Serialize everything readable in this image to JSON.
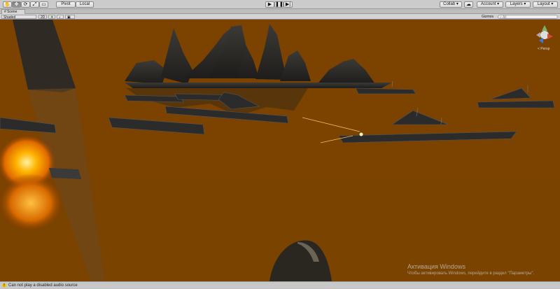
{
  "toolbar": {
    "tools": [
      "hand-icon",
      "move-icon",
      "rotate-icon",
      "scale-icon",
      "rect-icon"
    ],
    "pivot_label": "Pivot",
    "local_label": "Local",
    "collab_label": "Collab ▾",
    "account_label": "Account ▾",
    "layers_label": "Layers ▾",
    "layout_label": "Layout ▾"
  },
  "tabs": {
    "scene_label": "Scene"
  },
  "scenebar": {
    "shading_mode": "Shaded",
    "mode_2d": "2D",
    "gizmos_label": "Gizmos ▾",
    "search_placeholder": "All"
  },
  "viewport": {
    "persp_label": "< Persp",
    "sky_color": "#7d4300",
    "accent_colors": {
      "explosion": "#ffb000",
      "ship": "#2c2c2c"
    }
  },
  "status": {
    "message": "Can not play a disabled audio source"
  },
  "watermark": {
    "line1": "Активация Windows",
    "line2": "Чтобы активировать Windows, перейдите в раздел \"Параметры\"."
  }
}
